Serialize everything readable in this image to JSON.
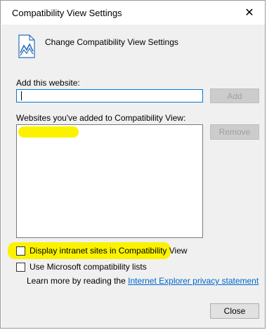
{
  "window": {
    "title": "Compatibility View Settings"
  },
  "header": {
    "title": "Change Compatibility View Settings",
    "icon": "document-chart-icon"
  },
  "add_website": {
    "label": "Add this website:",
    "value": "",
    "add_button": "Add"
  },
  "list": {
    "label": "Websites you've added to Compatibility View:",
    "remove_button": "Remove",
    "items": []
  },
  "options": [
    {
      "label": "Display intranet sites in Compatibility View",
      "checked": false
    },
    {
      "label": "Use Microsoft compatibility lists",
      "checked": false
    }
  ],
  "privacy": {
    "prefix": "Learn more by reading the",
    "link": "Internet Explorer privacy statement"
  },
  "footer": {
    "close_button": "Close"
  },
  "colors": {
    "highlight": "#fbf200",
    "link": "#0066cc",
    "focus_border": "#0078d7"
  }
}
